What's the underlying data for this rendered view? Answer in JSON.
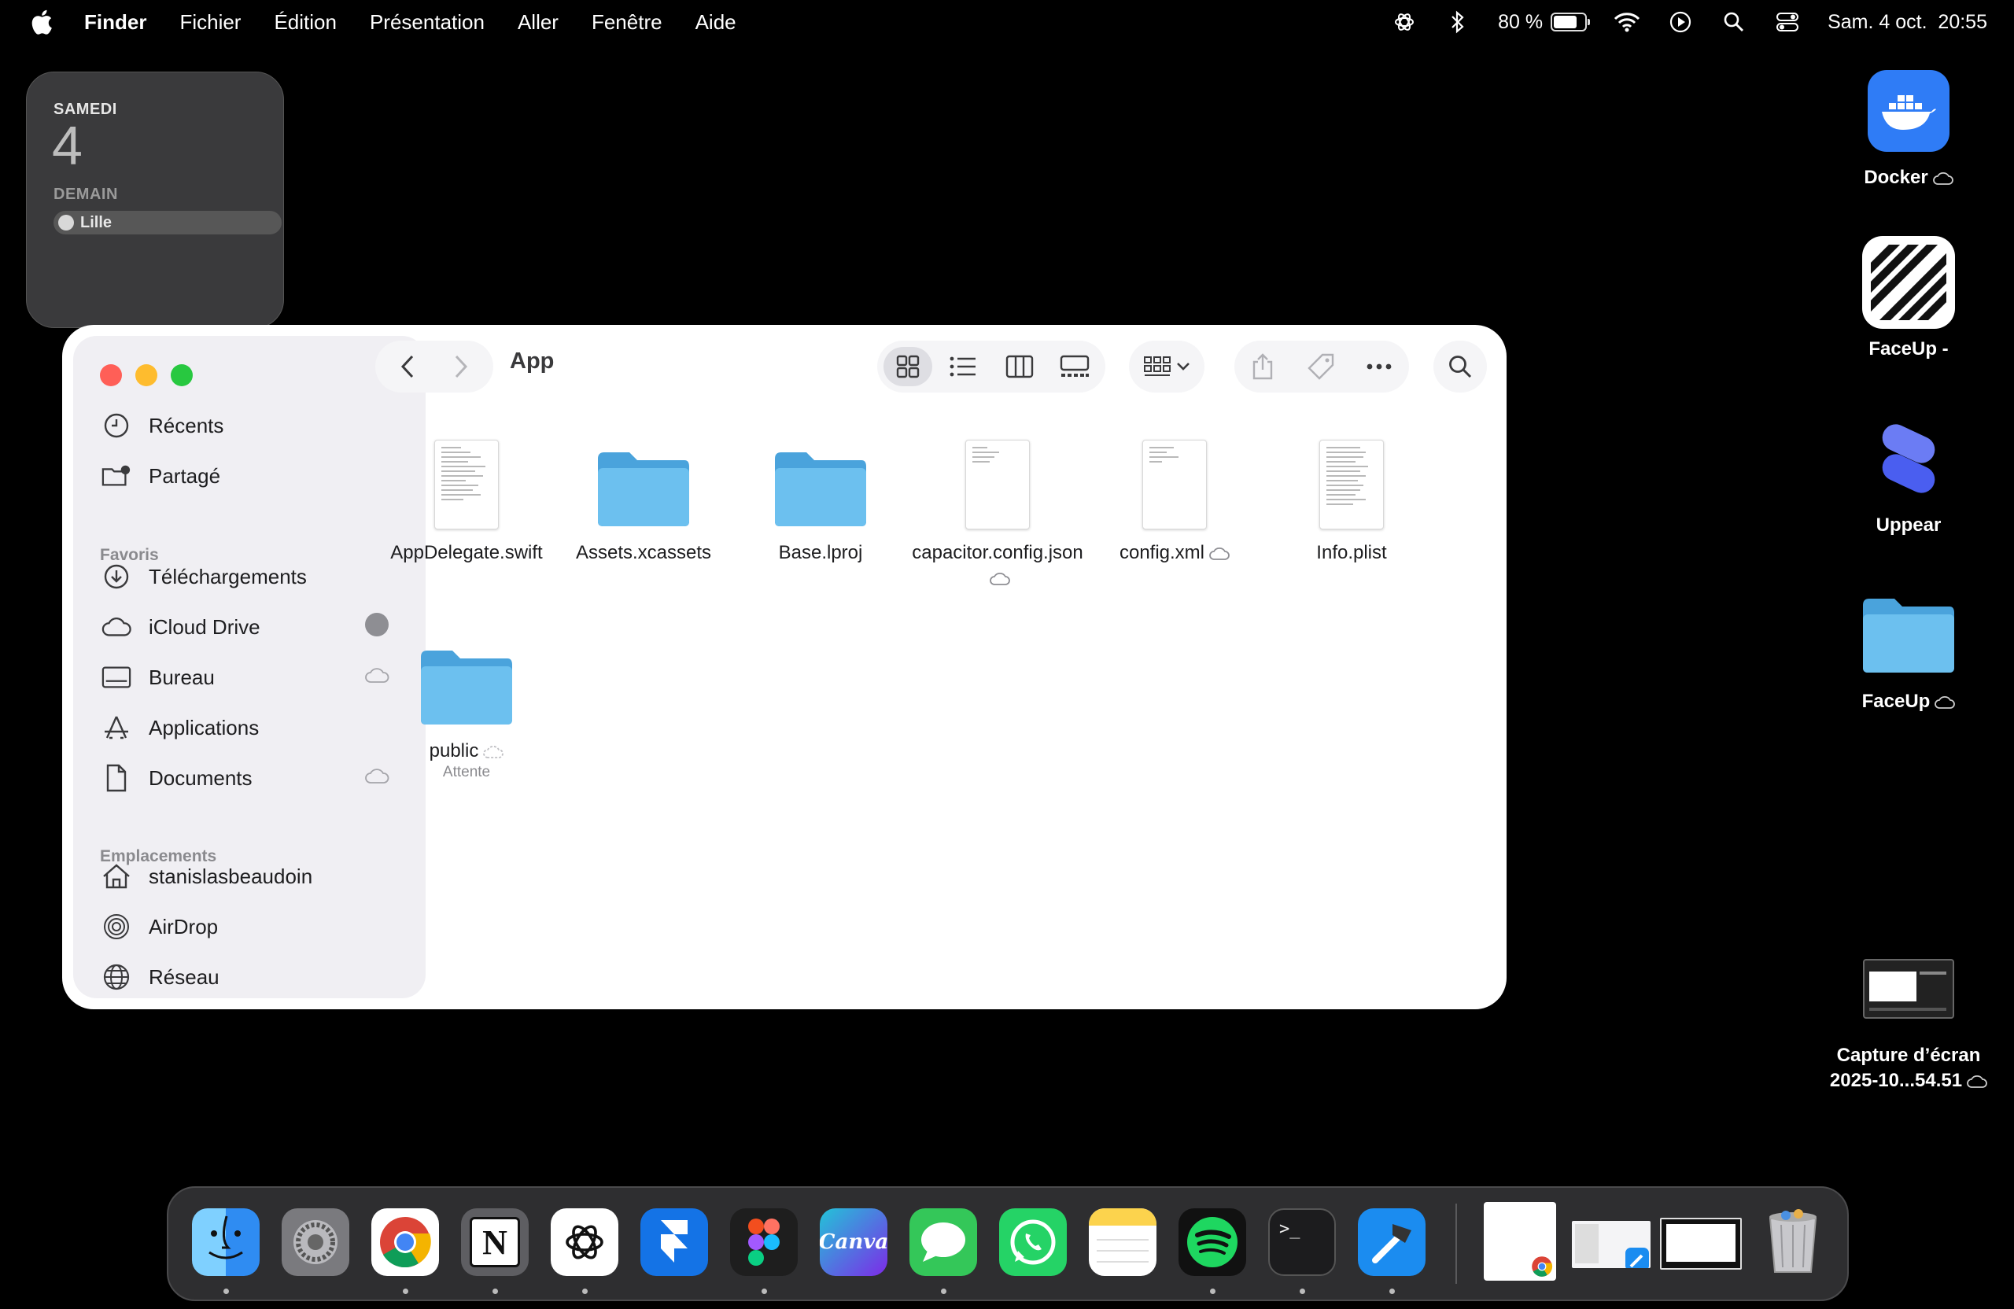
{
  "menubar": {
    "app": "Finder",
    "items": [
      "Fichier",
      "Édition",
      "Présentation",
      "Aller",
      "Fenêtre",
      "Aide"
    ],
    "battery": "80 %",
    "battery_level": 0.8,
    "datetime": "Sam. 4 oct.  20:55"
  },
  "widget": {
    "weekday": "SAMEDI",
    "day": "4",
    "tomorrow": "DEMAIN",
    "event": "Lille"
  },
  "finder": {
    "title": "App",
    "sidebar": {
      "top": [
        {
          "label": "Récents",
          "icon": "clock-icon"
        },
        {
          "label": "Partagé",
          "icon": "shared-folder-icon"
        }
      ],
      "favorites_title": "Favoris",
      "favorites": [
        {
          "label": "Téléchargements",
          "icon": "download-icon"
        },
        {
          "label": "iCloud Drive",
          "icon": "cloud-icon"
        },
        {
          "label": "Bureau",
          "icon": "desktop-icon"
        },
        {
          "label": "Applications",
          "icon": "applications-icon"
        },
        {
          "label": "Documents",
          "icon": "document-icon"
        }
      ],
      "locations_title": "Emplacements",
      "locations": [
        {
          "label": "stanislasbeaudoin",
          "icon": "home-icon"
        },
        {
          "label": "AirDrop",
          "icon": "airdrop-icon"
        },
        {
          "label": "Réseau",
          "icon": "network-icon"
        }
      ]
    },
    "files": [
      {
        "name": "AppDelegate.swift",
        "kind": "doc"
      },
      {
        "name": "Assets.xcassets",
        "kind": "folder"
      },
      {
        "name": "Base.lproj",
        "kind": "folder"
      },
      {
        "name": "capacitor.config.json",
        "kind": "doc",
        "cloud": true
      },
      {
        "name": "config.xml",
        "kind": "doc",
        "cloud": true
      },
      {
        "name": "Info.plist",
        "kind": "doc"
      },
      {
        "name": "public",
        "kind": "folder",
        "cloud": true,
        "status": "Attente"
      }
    ]
  },
  "desktop": [
    {
      "label": "Docker",
      "icon": "docker-icon",
      "cloud": true
    },
    {
      "label": "FaceUp -",
      "icon": "faceup-app-icon"
    },
    {
      "label": "Uppear",
      "icon": "uppear-icon"
    },
    {
      "label": "FaceUp",
      "icon": "folder-icon",
      "cloud": true
    },
    {
      "label": "Capture d’écran",
      "label2": "2025-10...54.51",
      "icon": "screenshot-icon",
      "cloud": true
    }
  ],
  "dock": {
    "apps": [
      "finder-icon",
      "settings-icon",
      "chrome-icon",
      "notion-icon",
      "chatgpt-icon",
      "framer-icon",
      "figma-icon",
      "canva-icon",
      "messages-icon",
      "whatsapp-icon",
      "notes-icon",
      "spotify-icon",
      "terminal-icon",
      "xcode-icon"
    ],
    "canva_label": "Canva",
    "terminal_label": ">_",
    "notion_label": "N"
  },
  "colors": {
    "close": "#ff5f57",
    "minimize": "#febc2e",
    "zoom": "#28c840",
    "folder": "#5ab4e8",
    "accent": "#2f7cf6"
  }
}
